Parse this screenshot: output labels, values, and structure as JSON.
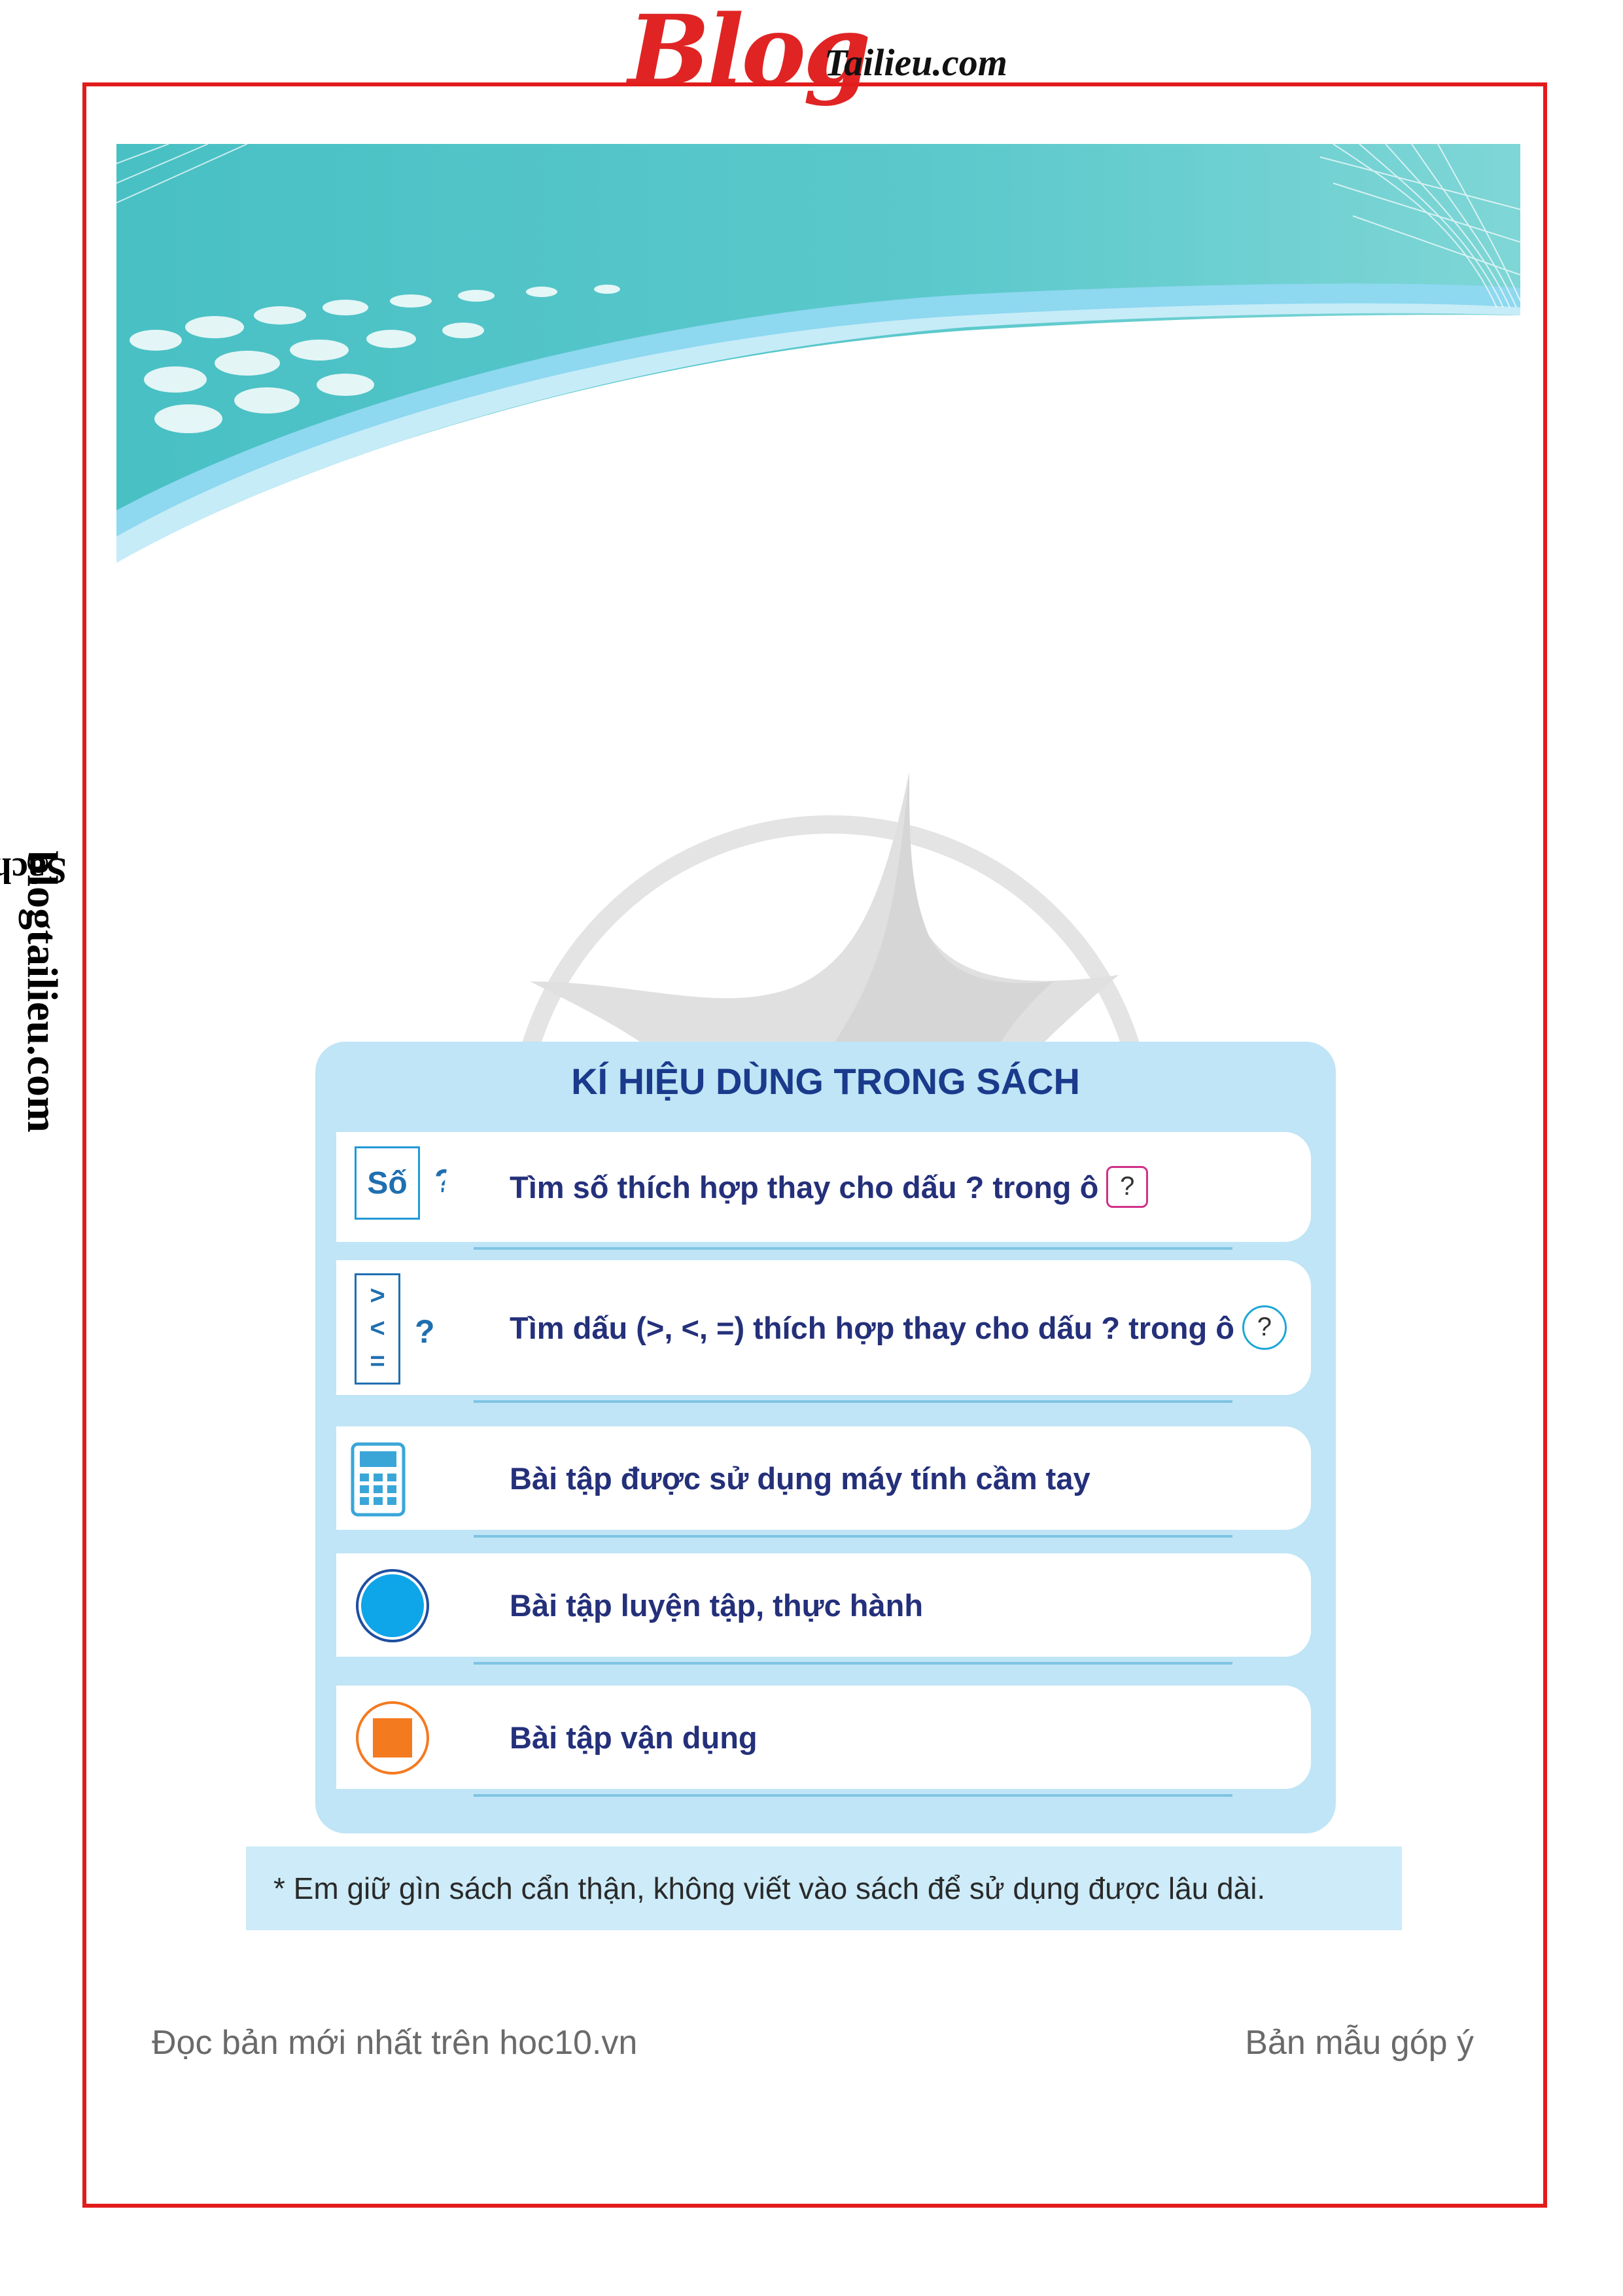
{
  "logo": {
    "blog": "Blog",
    "site": "Tailieu.com"
  },
  "sidebar": {
    "prefix": "Sách chia sẻ tại ",
    "domain": "blogtailieu.com"
  },
  "legend": {
    "title": "KÍ HIỆU DÙNG TRONG SÁCH",
    "rows": [
      {
        "icon": "so-box-icon",
        "icon_text": "Số",
        "icon_q": "?",
        "text": "Tìm số thích hợp thay cho dấu ? trong ô",
        "box_symbol": "?"
      },
      {
        "icon": "compare-signs-icon",
        "icon_lines": [
          ">",
          "<",
          "="
        ],
        "icon_q": "?",
        "text": "Tìm dấu (>, <, =) thích hợp thay cho dấu ? trong ô",
        "box_symbol": "?"
      },
      {
        "icon": "calculator-icon",
        "text": "Bài tập được sử dụng máy tính cầm tay"
      },
      {
        "icon": "blue-circle-icon",
        "text": "Bài tập luyện tập, thực hành"
      },
      {
        "icon": "orange-square-icon",
        "text": "Bài tập vận dụng"
      }
    ]
  },
  "note": "* Em giữ gìn sách cẩn thận, không viết vào sách để sử dụng được lâu dài.",
  "footer": {
    "left": "Đọc bản mới nhất trên hoc10.vn",
    "right": "Bản mẫu góp ý"
  },
  "colors": {
    "frame": "#e21b1b",
    "teal": "#4ec6c8",
    "legend_bg": "#bfe5f6",
    "title": "#1a3a8c",
    "blue_circle": "#0ea5e9",
    "orange": "#f47a20"
  }
}
